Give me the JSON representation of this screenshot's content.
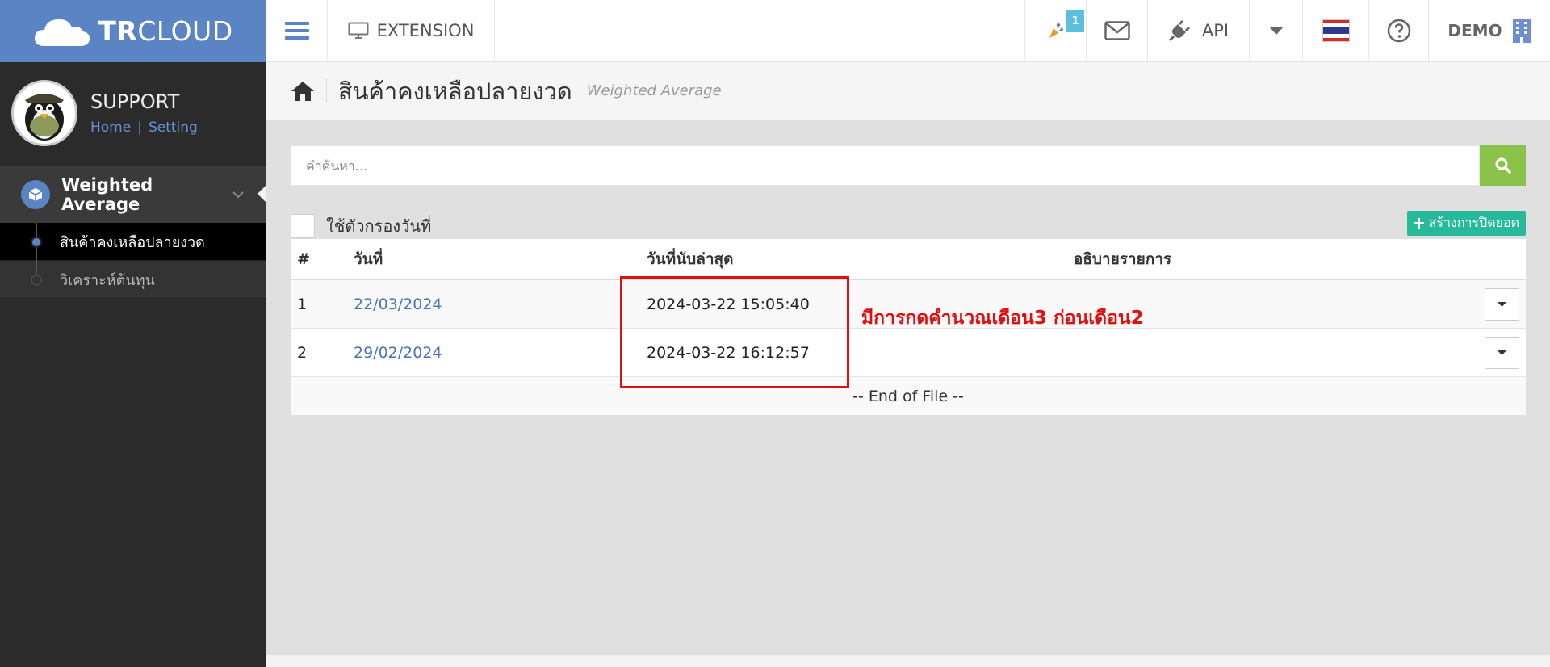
{
  "brand": {
    "logo_bold": "TR",
    "logo_light": "CLOUD"
  },
  "topbar": {
    "extension_label": "EXTENSION",
    "notification_count": "1",
    "api_label": "API",
    "company_label": "DEMO"
  },
  "sidebar": {
    "profile_name": "SUPPORT",
    "home_link": "Home",
    "link_separator": "|",
    "setting_link": "Setting",
    "section_label": "Weighted Average",
    "items": [
      {
        "label": "สินค้าคงเหลือปลายงวด",
        "active": true
      },
      {
        "label": "วิเคราะห์ต้นทุน",
        "active": false
      }
    ]
  },
  "page": {
    "title": "สินค้าคงเหลือปลายงวด",
    "subtitle": "Weighted Average"
  },
  "search": {
    "placeholder": "คำค้นหา..."
  },
  "filter": {
    "label": "ใช้ตัวกรองวันที่",
    "checked": false
  },
  "create_button": {
    "label": "สร้างการปิดยอด"
  },
  "table": {
    "headers": [
      "#",
      "วันที่",
      "วันที่นับล่าสุด",
      "อธิบายรายการ"
    ],
    "rows": [
      {
        "num": "1",
        "date": "22/03/2024",
        "counted": "2024-03-22 15:05:40",
        "desc": ""
      },
      {
        "num": "2",
        "date": "29/02/2024",
        "counted": "2024-03-22 16:12:57",
        "desc": ""
      }
    ],
    "footer": "-- End of File --"
  },
  "annotation": {
    "text": "มีการกดคำนวณเดือน3 ก่อนเดือน2",
    "color": "#e01010"
  },
  "colors": {
    "brand_blue": "#5b84c4",
    "search_green": "#8bc34a",
    "create_teal": "#26b99a",
    "link_blue": "#4a74b8"
  }
}
